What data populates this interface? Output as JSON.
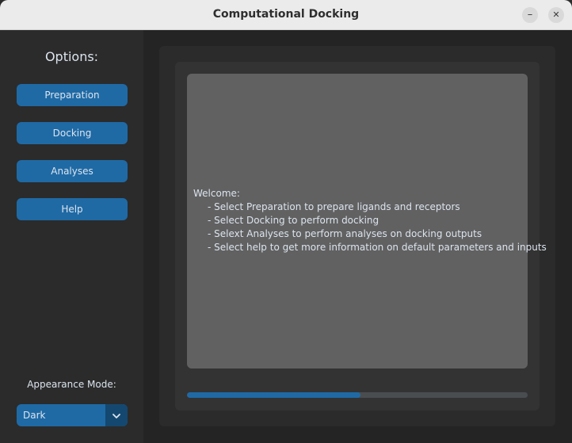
{
  "window": {
    "title": "Computational Docking",
    "minimize_glyph": "–",
    "close_glyph": "✕"
  },
  "sidebar": {
    "title": "Options:",
    "buttons": [
      {
        "label": "Preparation"
      },
      {
        "label": "Docking"
      },
      {
        "label": "Analyses"
      },
      {
        "label": "Help"
      }
    ],
    "appearance_label": "Appearance Mode:",
    "appearance_value": "Dark",
    "appearance_icon": "chevron-down-icon"
  },
  "main": {
    "welcome": {
      "heading": "Welcome:",
      "lines": [
        "- Select Preparation to prepare ligands and receptors",
        "- Select Docking to perform docking",
        "- Selext Analyses to perform analyses on docking outputs",
        "- Select help to get more information on default parameters and inputs"
      ]
    },
    "progress": 0.51
  },
  "colors": {
    "accent": "#1f6aa5",
    "accent_dark": "#144870",
    "text": "#dce4ee",
    "textbox_bg": "#616161"
  }
}
